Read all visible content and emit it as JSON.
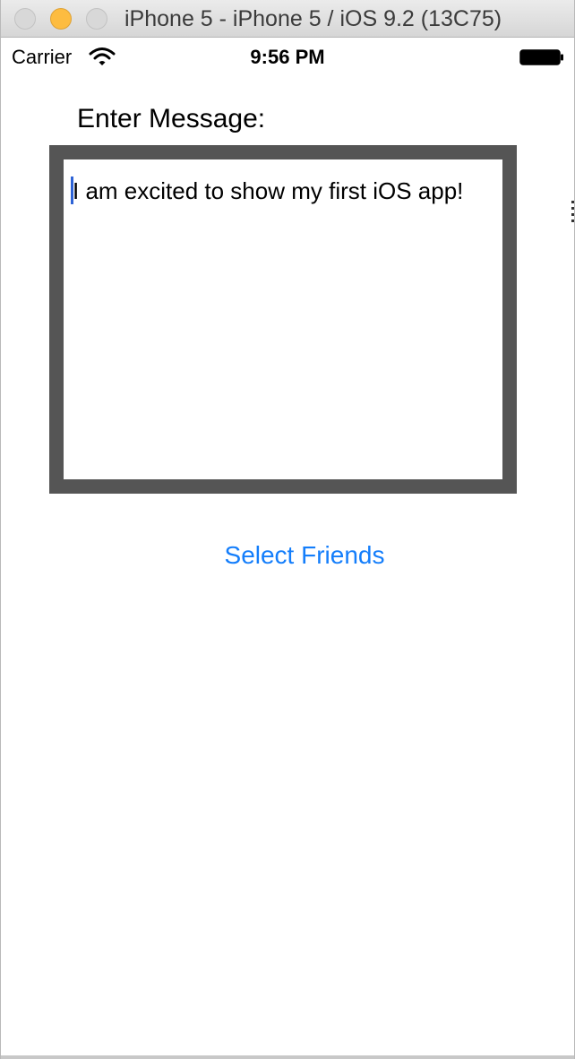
{
  "window": {
    "title": "iPhone 5 - iPhone 5 / iOS 9.2 (13C75)"
  },
  "status_bar": {
    "carrier": "Carrier",
    "time": "9:56 PM",
    "wifi_icon": "wifi-icon",
    "battery_icon": "battery-icon"
  },
  "main": {
    "prompt_label": "Enter Message:",
    "message_text": "I am excited to show my first iOS app!",
    "select_friends_label": "Select Friends"
  },
  "colors": {
    "link": "#147efb",
    "frame": "#555555",
    "caret": "#2e63d6"
  }
}
